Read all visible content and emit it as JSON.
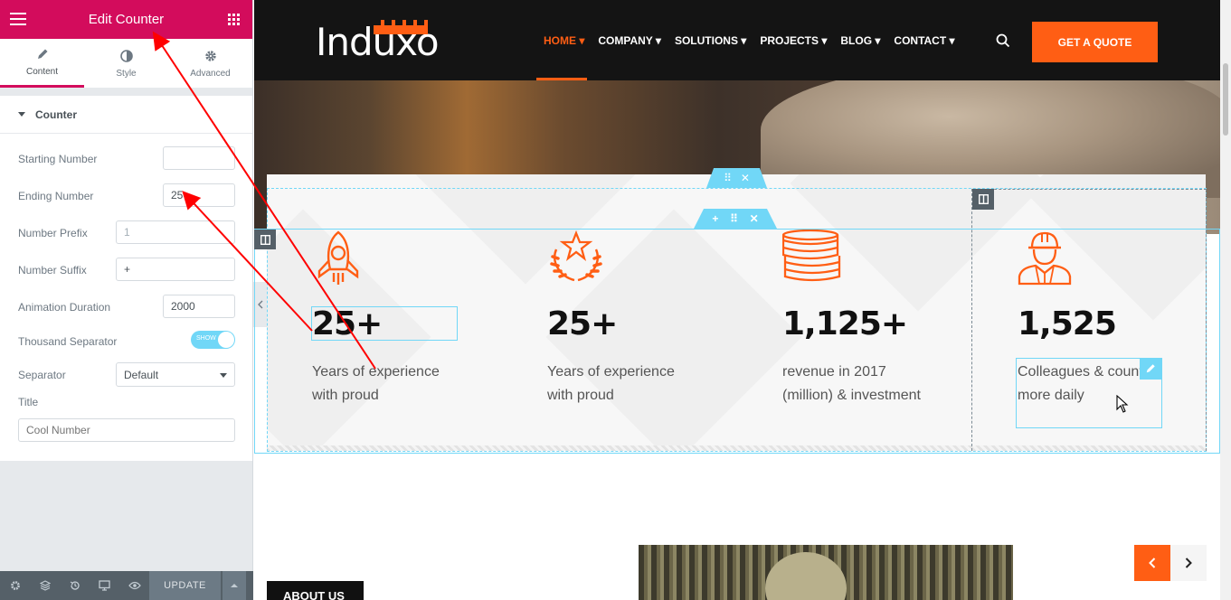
{
  "editor": {
    "title": "Edit Counter",
    "tabs": [
      {
        "label": "Content",
        "icon": "pencil-icon",
        "active": true
      },
      {
        "label": "Style",
        "icon": "half-circle-icon",
        "active": false
      },
      {
        "label": "Advanced",
        "icon": "gear-icon",
        "active": false
      }
    ],
    "section": "Counter",
    "controls": {
      "starting_number": {
        "label": "Starting Number",
        "value": ""
      },
      "ending_number": {
        "label": "Ending Number",
        "value": "25"
      },
      "number_prefix": {
        "label": "Number Prefix",
        "placeholder": "1",
        "value": ""
      },
      "number_suffix": {
        "label": "Number Suffix",
        "value": "+"
      },
      "animation_duration": {
        "label": "Animation Duration",
        "value": "2000"
      },
      "thousand_separator": {
        "label": "Thousand Separator",
        "toggle_text": "SHOW",
        "on": true
      },
      "separator": {
        "label": "Separator",
        "selected": "Default"
      },
      "title": {
        "label": "Title",
        "placeholder": "Cool Number",
        "value": ""
      }
    },
    "footer": {
      "update_label": "UPDATE"
    }
  },
  "site": {
    "logo": "Induxo",
    "nav": [
      {
        "label": "HOME",
        "active": true
      },
      {
        "label": "COMPANY",
        "active": false
      },
      {
        "label": "SOLUTIONS",
        "active": false
      },
      {
        "label": "PROJECTS",
        "active": false
      },
      {
        "label": "BLOG",
        "active": false
      },
      {
        "label": "CONTACT",
        "active": false
      }
    ],
    "cta": "GET A QUOTE",
    "accent": "#ff5e14",
    "counters": [
      {
        "icon": "rocket-icon",
        "number": "25+",
        "title_lines": [
          "Years of experience",
          "with proud"
        ]
      },
      {
        "icon": "star-laurel-icon",
        "number": "25+",
        "title_lines": [
          "Years of experience",
          "with proud"
        ]
      },
      {
        "icon": "coins-icon",
        "number": "1,125+",
        "title_lines": [
          "revenue in 2017",
          "(million) & investment"
        ]
      },
      {
        "icon": "worker-icon",
        "number": "1,525",
        "title_lines": [
          "Colleagues & count",
          "more daily"
        ]
      }
    ],
    "about_label": "ABOUT US"
  },
  "colors": {
    "editor_brand": "#d30c5c",
    "selection": "#71d7f7",
    "annotation": "#ff0000"
  }
}
